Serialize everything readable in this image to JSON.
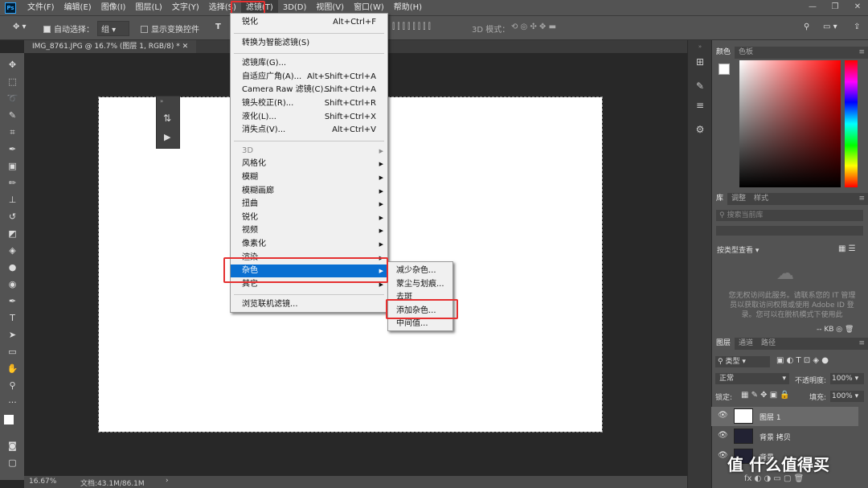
{
  "app": {
    "logo_text": "Ps"
  },
  "menubar": {
    "items": [
      "文件(F)",
      "编辑(E)",
      "图像(I)",
      "图层(L)",
      "文字(Y)",
      "选择(S)",
      "滤镜(T)",
      "3D(D)",
      "视图(V)",
      "窗口(W)",
      "帮助(H)"
    ],
    "active_index": 6,
    "window_controls": [
      "—",
      "❐",
      "✕"
    ]
  },
  "options_bar": {
    "auto_select_label": "自动选择：",
    "auto_select_value": "组",
    "show_transform_label": "显示变换控件",
    "mode_3d_label": "3D 模式："
  },
  "document_tab": {
    "title": "IMG_8761.JPG @ 16.7% (图层 1, RGB/8) *"
  },
  "status_bar": {
    "zoom": "16.67%",
    "doc_info": "文档:43.1M/86.1M"
  },
  "filter_menu": {
    "items": [
      {
        "label": "锐化",
        "shortcut": "Alt+Ctrl+F"
      },
      {
        "sep": true
      },
      {
        "label": "转换为智能滤镜(S)"
      },
      {
        "sep": true
      },
      {
        "label": "滤镜库(G)..."
      },
      {
        "label": "自适应广角(A)...",
        "shortcut": "Alt+Shift+Ctrl+A"
      },
      {
        "label": "Camera Raw 滤镜(C)...",
        "shortcut": "Shift+Ctrl+A"
      },
      {
        "label": "镜头校正(R)...",
        "shortcut": "Shift+Ctrl+R"
      },
      {
        "label": "液化(L)...",
        "shortcut": "Shift+Ctrl+X"
      },
      {
        "label": "消失点(V)...",
        "shortcut": "Alt+Ctrl+V"
      },
      {
        "sep": true
      },
      {
        "label": "3D",
        "submenu": true,
        "disabled": true
      },
      {
        "label": "风格化",
        "submenu": true
      },
      {
        "label": "模糊",
        "submenu": true
      },
      {
        "label": "模糊画廊",
        "submenu": true
      },
      {
        "label": "扭曲",
        "submenu": true
      },
      {
        "label": "锐化",
        "submenu": true
      },
      {
        "label": "视频",
        "submenu": true
      },
      {
        "label": "像素化",
        "submenu": true
      },
      {
        "label": "渲染",
        "submenu": true
      },
      {
        "label": "杂色",
        "submenu": true,
        "highlighted": true
      },
      {
        "label": "其它",
        "submenu": true
      },
      {
        "sep": true
      },
      {
        "label": "浏览联机滤镜..."
      }
    ]
  },
  "noise_submenu": {
    "items": [
      "减少杂色...",
      "蒙尘与划痕...",
      "去斑",
      "添加杂色...",
      "中间值..."
    ],
    "boxed_index": 3
  },
  "color_panel": {
    "tabs": [
      "颜色",
      "色板"
    ]
  },
  "library_panel": {
    "tabs": [
      "库",
      "调整",
      "样式"
    ],
    "search_placeholder": "搜索当前库",
    "view_label": "按类型查看",
    "notice": "您无权访问此服务。请联系您的 IT 管理员以获取访问权限或使用 Adobe ID 登录。您可以在脱机模式下使用此",
    "size_label": "-- KB"
  },
  "layers_panel": {
    "tabs": [
      "图层",
      "通道",
      "路径"
    ],
    "kind_label": "类型",
    "blend_mode": "正常",
    "opacity_label": "不透明度:",
    "opacity_value": "100%",
    "lock_label": "锁定:",
    "fill_label": "填充:",
    "fill_value": "100%",
    "layers": [
      "图层 1",
      "背景 拷贝",
      "背景"
    ]
  },
  "watermark": {
    "text": "值 什么值得买"
  }
}
